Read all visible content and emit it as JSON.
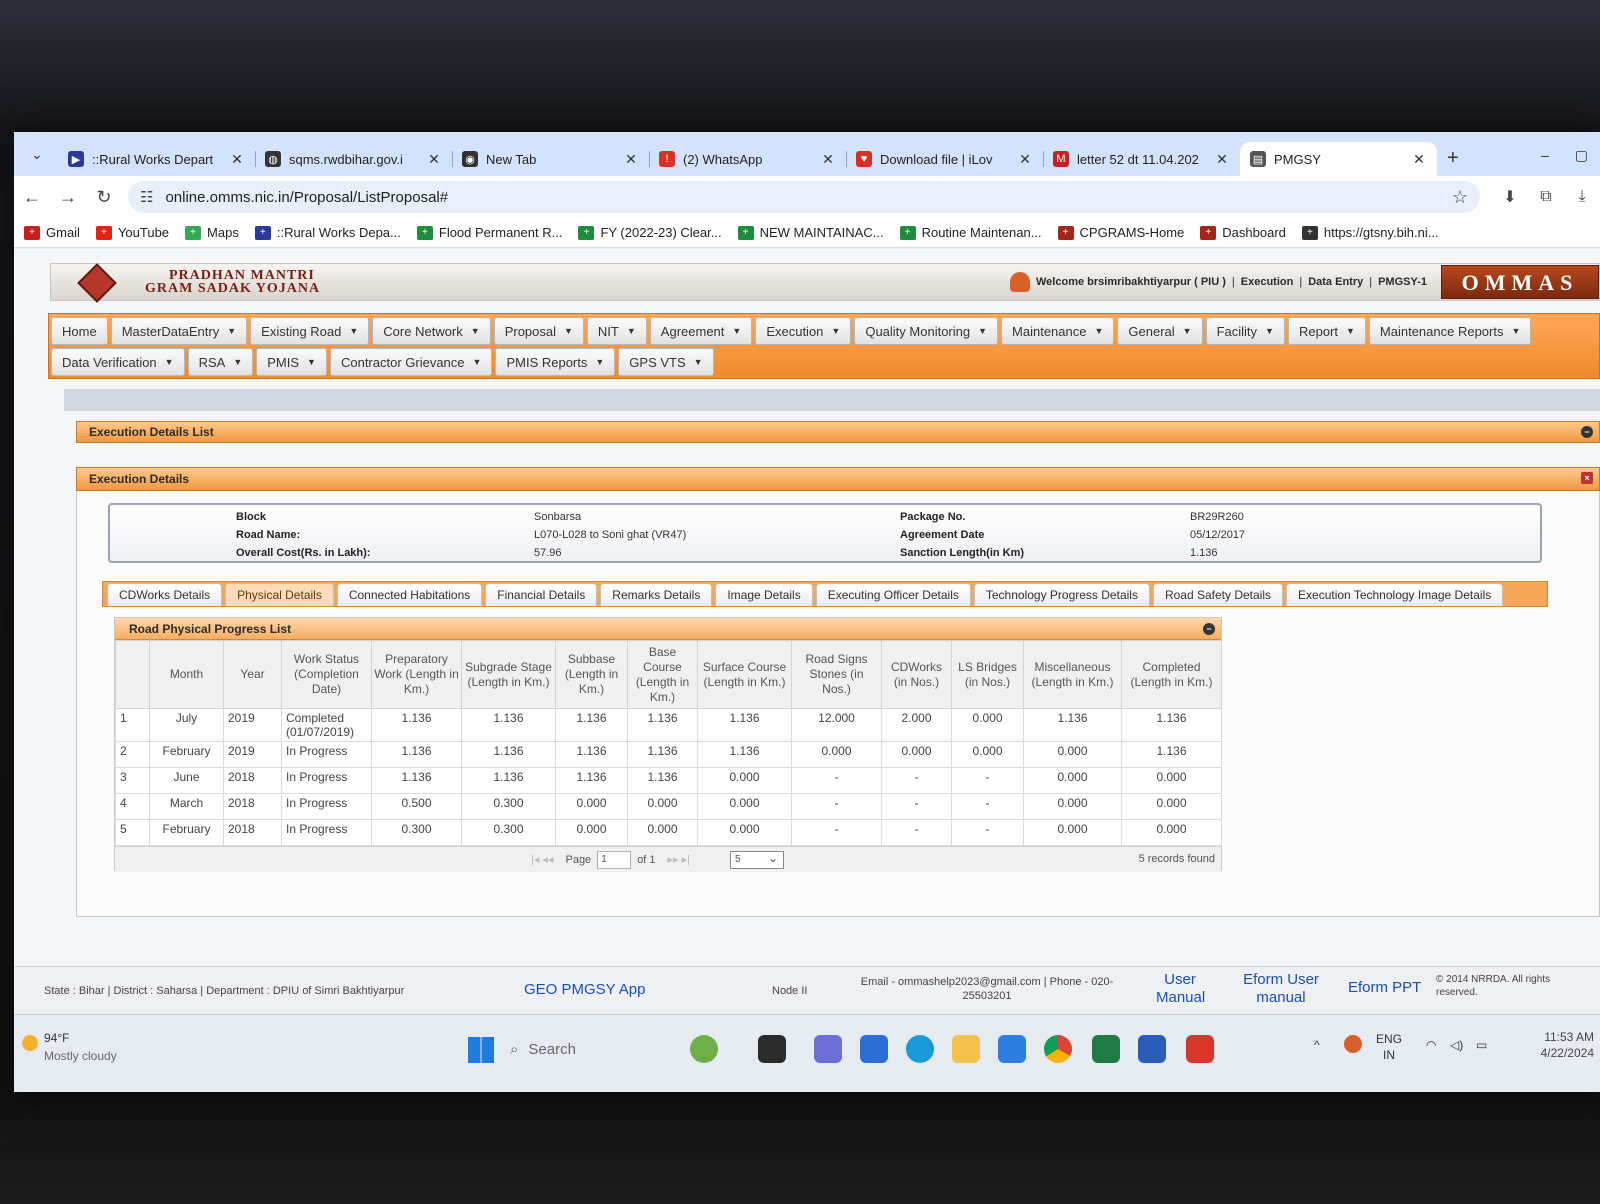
{
  "browser": {
    "tabs": [
      {
        "label": "::Rural Works Depart",
        "icon": "app-icon",
        "color": "#2b3a9a"
      },
      {
        "label": "sqms.rwdbihar.gov.i",
        "icon": "globe-icon",
        "color": "#333333"
      },
      {
        "label": "New Tab",
        "icon": "chrome-icon",
        "color": "#333333"
      },
      {
        "label": "(2) WhatsApp",
        "icon": "whatsapp-icon",
        "color": "#d93025"
      },
      {
        "label": "Download file | iLov",
        "icon": "heart-icon",
        "color": "#d93025"
      },
      {
        "label": "letter 52 dt 11.04.202",
        "icon": "gmail-icon",
        "color": "#c5221f"
      },
      {
        "label": "PMGSY",
        "icon": "page-icon",
        "color": "#555555"
      }
    ],
    "url": "online.omms.nic.in/Proposal/ListProposal#",
    "bookmarks": [
      {
        "label": "Gmail",
        "color": "#c5221f"
      },
      {
        "label": "YouTube",
        "color": "#e62117"
      },
      {
        "label": "Maps",
        "color": "#34a853"
      },
      {
        "label": "::Rural Works Depa...",
        "color": "#2b3a9a"
      },
      {
        "label": "Flood Permanent R...",
        "color": "#1e8e3e"
      },
      {
        "label": "FY (2022-23) Clear...",
        "color": "#1e8e3e"
      },
      {
        "label": "NEW MAINTAINAC...",
        "color": "#1e8e3e"
      },
      {
        "label": "Routine Maintenan...",
        "color": "#1e8e3e"
      },
      {
        "label": "CPGRAMS-Home",
        "color": "#a3251b"
      },
      {
        "label": "Dashboard",
        "color": "#a3251b"
      },
      {
        "label": "https://gtsny.bih.ni...",
        "color": "#333333"
      }
    ]
  },
  "header": {
    "brand_line1": "PRADHAN MANTRI",
    "brand_line2": "GRAM SADAK YOJANA",
    "welcome": "Welcome brsimribakhtiyarpur ( PIU )",
    "role1": "Execution",
    "role2": "Data Entry",
    "role3": "PMGSY-1",
    "logo_text": "OMMAS"
  },
  "menu": {
    "row1": [
      "Home",
      "MasterDataEntry",
      "Existing Road",
      "Core Network",
      "Proposal",
      "NIT",
      "Agreement",
      "Execution",
      "Quality Monitoring",
      "Maintenance",
      "General",
      "Facility",
      "Report",
      "Maintenance Reports"
    ],
    "row2": [
      "Data Verification",
      "RSA",
      "PMIS",
      "Contractor Grievance",
      "PMIS Reports",
      "GPS VTS"
    ]
  },
  "panels": {
    "list_title": "Execution Details List",
    "details_title": "Execution Details"
  },
  "info": {
    "block_label": "Block",
    "block_value": "Sonbarsa",
    "road_label": "Road Name:",
    "road_value": "L070-L028 to Soni ghat (VR47)",
    "cost_label": "Overall Cost(Rs. in Lakh):",
    "cost_value": "57.96",
    "package_label": "Package No.",
    "package_value": "BR29R260",
    "agreement_label": "Agreement Date",
    "agreement_value": "05/12/2017",
    "sanction_label": "Sanction Length(in Km)",
    "sanction_value": "1.136"
  },
  "detail_tabs": [
    "CDWorks Details",
    "Physical Details",
    "Connected Habitations",
    "Financial Details",
    "Remarks Details",
    "Image Details",
    "Executing Officer Details",
    "Technology Progress Details",
    "Road Safety Details",
    "Execution Technology Image Details"
  ],
  "grid": {
    "title": "Road Physical Progress List",
    "columns": [
      "",
      "Month",
      "Year",
      "Work Status (Completion Date)",
      "Preparatory Work (Length in Km.)",
      "Subgrade Stage (Length in Km.)",
      "Subbase (Length in Km.)",
      "Base Course (Length in Km.)",
      "Surface Course (Length in Km.)",
      "Road Signs Stones (in Nos.)",
      "CDWorks (in Nos.)",
      "LS Bridges (in Nos.)",
      "Miscellaneous (Length in Km.)",
      "Completed (Length in Km.)"
    ],
    "rows": [
      [
        "1",
        "July",
        "2019",
        "Completed (01/07/2019)",
        "1.136",
        "1.136",
        "1.136",
        "1.136",
        "1.136",
        "12.000",
        "2.000",
        "0.000",
        "1.136",
        "1.136"
      ],
      [
        "2",
        "February",
        "2019",
        "In Progress",
        "1.136",
        "1.136",
        "1.136",
        "1.136",
        "1.136",
        "0.000",
        "0.000",
        "0.000",
        "0.000",
        "1.136"
      ],
      [
        "3",
        "June",
        "2018",
        "In Progress",
        "1.136",
        "1.136",
        "1.136",
        "1.136",
        "0.000",
        "-",
        "-",
        "-",
        "0.000",
        "0.000"
      ],
      [
        "4",
        "March",
        "2018",
        "In Progress",
        "0.500",
        "0.300",
        "0.000",
        "0.000",
        "0.000",
        "-",
        "-",
        "-",
        "0.000",
        "0.000"
      ],
      [
        "5",
        "February",
        "2018",
        "In Progress",
        "0.300",
        "0.300",
        "0.000",
        "0.000",
        "0.000",
        "-",
        "-",
        "-",
        "0.000",
        "0.000"
      ]
    ],
    "pager": {
      "page_label": "Page",
      "page_value": "1",
      "of_label": "of 1",
      "page_size": "5",
      "records": "5 records found"
    }
  },
  "footer": {
    "location": "State : Bihar  |  District : Saharsa  |  Department : DPIU of Simri Bakhtiyarpur",
    "geo_app": "GEO PMGSY App",
    "node": "Node II",
    "contact": "Email - ommashelp2023@gmail.com  |  Phone - 020-25503201",
    "user_manual": "User Manual",
    "eform_manual": "Eform User manual",
    "eform_ppt": "Eform PPT",
    "copyright": "© 2014 NRRDA. All rights reserved."
  },
  "taskbar": {
    "temp": "94°F",
    "condition": "Mostly cloudy",
    "search": "Search",
    "lang1": "ENG",
    "lang2": "IN",
    "time": "11:53 AM",
    "date": "4/22/2024"
  }
}
